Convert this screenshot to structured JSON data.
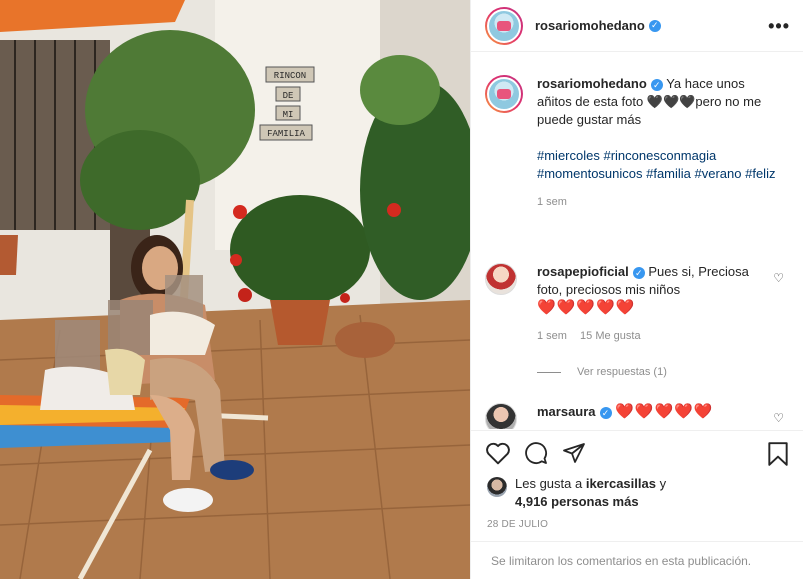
{
  "post": {
    "author": "rosariomohedano",
    "photo_sign_lines": [
      "RINCON",
      "DE",
      "MI",
      "FAMILIA"
    ]
  },
  "header": {
    "username": "rosariomohedano",
    "more_label": "•••"
  },
  "caption": {
    "username": "rosariomohedano",
    "text": "Ya hace unos añitos de esta foto 🖤🖤🖤pero no me puede gustar más",
    "hashtags": "#miercoles #rinconesconmagia #momentosunicos #familia #verano #feliz",
    "time": "1 sem"
  },
  "comments": [
    {
      "username": "rosapepioficial",
      "text": "Pues si, Preciosa foto, preciosos mis niños",
      "hearts": "❤️❤️❤️❤️❤️",
      "time": "1 sem",
      "likes": "15 Me gusta",
      "view_replies": "Ver respuestas (1)"
    },
    {
      "username": "marsaura",
      "hearts": "❤️❤️❤️❤️❤️"
    }
  ],
  "likes": {
    "prefix": "Les gusta a",
    "user": "ikercasillas",
    "suffix": "y",
    "count_text": "4,916 personas más"
  },
  "date": "28 DE JULIO",
  "comments_disabled": "Se limitaron los comentarios en esta publicación.",
  "colors": {
    "link": "#00376b",
    "verified": "#3897f0",
    "heart": "#ed1c24",
    "muted": "#8e8e8e"
  },
  "icons": [
    "heart-icon",
    "comment-icon",
    "share-icon",
    "bookmark-icon",
    "more-icon",
    "verified-icon"
  ]
}
